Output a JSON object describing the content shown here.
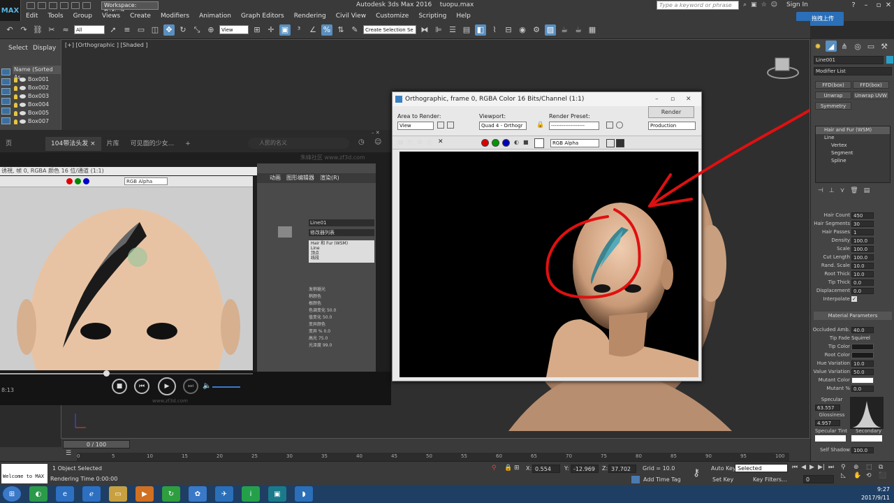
{
  "app": {
    "title": "Autodesk 3ds Max 2016",
    "filename": "tuopu.max",
    "logo_text": "MAX",
    "workspace": "Workspace: Default",
    "search_placeholder": "Type a keyword or phrase",
    "signin": "Sign In",
    "cloud_btn": "拖拽上传"
  },
  "menu": [
    "Edit",
    "Tools",
    "Group",
    "Views",
    "Create",
    "Modifiers",
    "Animation",
    "Graph Editors",
    "Rendering",
    "Civil View",
    "Customize",
    "Scripting",
    "Help"
  ],
  "toolbar": {
    "filter": "All",
    "ref_coord": "View",
    "selection_set": "Create Selection Se"
  },
  "scene_explorer": {
    "tabs": [
      "Select",
      "Display"
    ],
    "header": "Name (Sorted As",
    "items": [
      "Box001",
      "Box002",
      "Box003",
      "Box004",
      "Box005",
      "Box007"
    ]
  },
  "viewport": {
    "label": "[+] [Orthographic ] [Shaded ]"
  },
  "video_player": {
    "tabs": [
      "104带法头发",
      "片库",
      "可见面的少女..."
    ],
    "search_placeholder": "人民的名义",
    "frame_title": "诱視, 帧 0, RGBA 颜色 16 位/通道 (1:1)",
    "channel": "RGB Alpha",
    "time": "8:13",
    "watermark": "www.zf3d.com",
    "watermark_top": "朱峰社区 www.zf3d.com",
    "right_menu": [
      "动画",
      "图形编辑器",
      "渲染(R)"
    ],
    "right_name": "Line01",
    "right_modlist": "修改器列表",
    "right_stack": [
      "Hair 和 Fur (WSM)",
      "Line",
      "顶点",
      "线段"
    ],
    "right_params": [
      "发梢褪光",
      "梢颜色",
      "根颜色",
      "色调变化",
      "值变化",
      "变异颜色",
      "变异 %",
      "高光",
      "光泽度"
    ],
    "right_values": [
      "50.0",
      "50.0",
      "0.0",
      "75.0",
      "99.0"
    ]
  },
  "render_window": {
    "title": "Orthographic, frame 0, RGBA Color 16 Bits/Channel (1:1)",
    "area_label": "Area to Render:",
    "area_value": "View",
    "viewport_label": "Viewport:",
    "viewport_value": "Quad 4 - Orthogr",
    "preset_label": "Render Preset:",
    "preset_value": "-------------------",
    "render_btn": "Render",
    "production": "Production",
    "channel": "RGB Alpha"
  },
  "command_panel": {
    "object_name": "Line001",
    "modifier_list": "Modifier List",
    "buttons": [
      "FFD(box)",
      "FFD(box)",
      "Unwrap",
      "Unwrap UVW",
      "Symmetry"
    ],
    "stack": [
      "Hair and Fur (WSM)",
      "Line",
      "Vertex",
      "Segment",
      "Spline"
    ],
    "params": [
      {
        "label": "Hair Count",
        "value": "450"
      },
      {
        "label": "Hair Segments",
        "value": "30"
      },
      {
        "label": "Hair Passes",
        "value": "1"
      },
      {
        "label": "Density",
        "value": "100.0"
      },
      {
        "label": "Scale",
        "value": "100.0"
      },
      {
        "label": "Cut Length",
        "value": "100.0"
      },
      {
        "label": "Rand. Scale",
        "value": "10.0"
      },
      {
        "label": "Root Thick",
        "value": "10.0"
      },
      {
        "label": "Tip Thick",
        "value": "0.0"
      },
      {
        "label": "Displacement",
        "value": "0.0"
      }
    ],
    "interpolate": "Interpolate",
    "material_title": "Material Parameters",
    "mat_params": [
      {
        "label": "Occluded Amb.",
        "value": "40.0"
      },
      {
        "label": "Tip Fade",
        "value": "Squirrel"
      },
      {
        "label": "Tip Color",
        "value": ""
      },
      {
        "label": "Root Color",
        "value": ""
      },
      {
        "label": "Hue Variation",
        "value": "10.0"
      },
      {
        "label": "Value Variation",
        "value": "50.0"
      },
      {
        "label": "Mutant Color",
        "value": ""
      },
      {
        "label": "Mutant %",
        "value": "0.0"
      }
    ],
    "specular_label": "Specular",
    "specular_value": "63.557",
    "glossiness_label": "Glossiness",
    "glossiness_value": "4.957",
    "spec_tint": "Specular Tint",
    "secondary": "Secondary",
    "self_shadow": "Self Shadow",
    "self_shadow_value": "100.0"
  },
  "timeline": {
    "slider": "0 / 100",
    "ticks": [
      "0",
      "5",
      "10",
      "15",
      "20",
      "25",
      "30",
      "35",
      "40",
      "45",
      "50",
      "55",
      "60",
      "65",
      "70",
      "75",
      "80",
      "85",
      "90",
      "95",
      "100"
    ]
  },
  "status": {
    "maxscript": "Welcome to MAX",
    "selected": "1 Object Selected",
    "render_time": "Rendering Time 0:00:00",
    "x_label": "X:",
    "x": "0.554",
    "y_label": "Y:",
    "y": "-12.969",
    "z_label": "Z:",
    "z": "37.702",
    "grid": "Grid = 10.0",
    "add_time_tag": "Add Time Tag",
    "auto_key": "Auto Key",
    "set_key": "Set Key",
    "key_mode": "Selected",
    "key_filters": "Key Filters...",
    "frame": "0"
  },
  "taskbar": {
    "time": "9:27",
    "date": "2017/9/11"
  },
  "colors": {
    "annotation": "#e01010",
    "accent": "#5a8fbf",
    "skin": "#e8c2a0"
  }
}
